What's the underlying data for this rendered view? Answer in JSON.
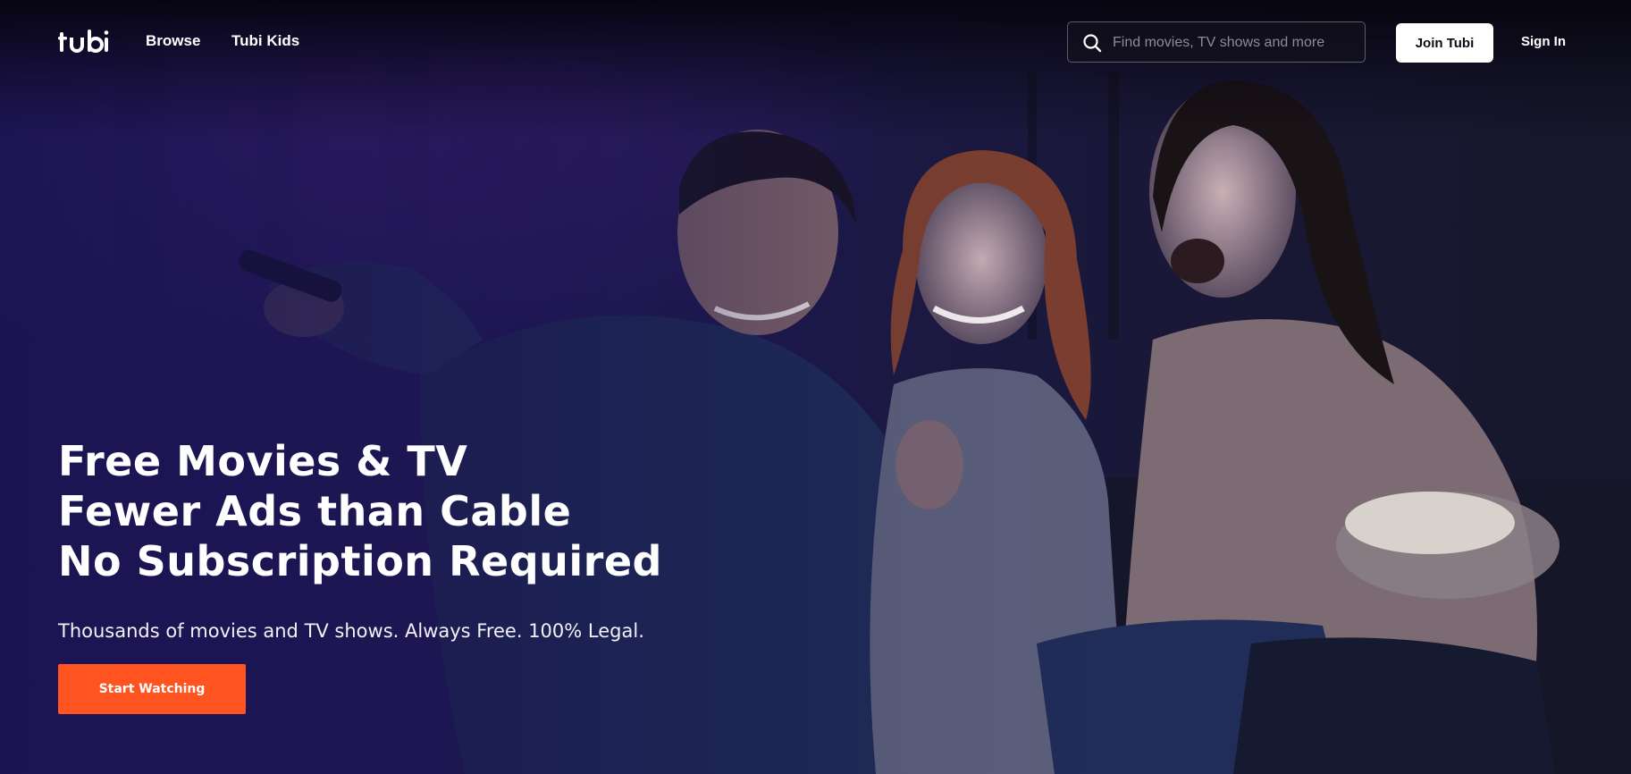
{
  "header": {
    "logo_text": "tubi",
    "nav": [
      {
        "label": "Browse"
      },
      {
        "label": "Tubi Kids"
      }
    ],
    "search": {
      "placeholder": "Find movies, TV shows and more",
      "value": ""
    },
    "join_label": "Join Tubi",
    "signin_label": "Sign In"
  },
  "hero": {
    "headline_lines": [
      "Free Movies & TV",
      "Fewer Ads than Cable",
      "No Subscription Required"
    ],
    "subheadline": "Thousands of movies and TV shows. Always Free. 100% Legal.",
    "cta_label": "Start Watching",
    "image_subject": "three friends laughing on a couch at night, one holding a TV remote, one holding a bowl of popcorn"
  },
  "colors": {
    "cta": "#ff5420",
    "join_button_bg": "#ffffff",
    "overlay_tint": "#1a1450"
  }
}
